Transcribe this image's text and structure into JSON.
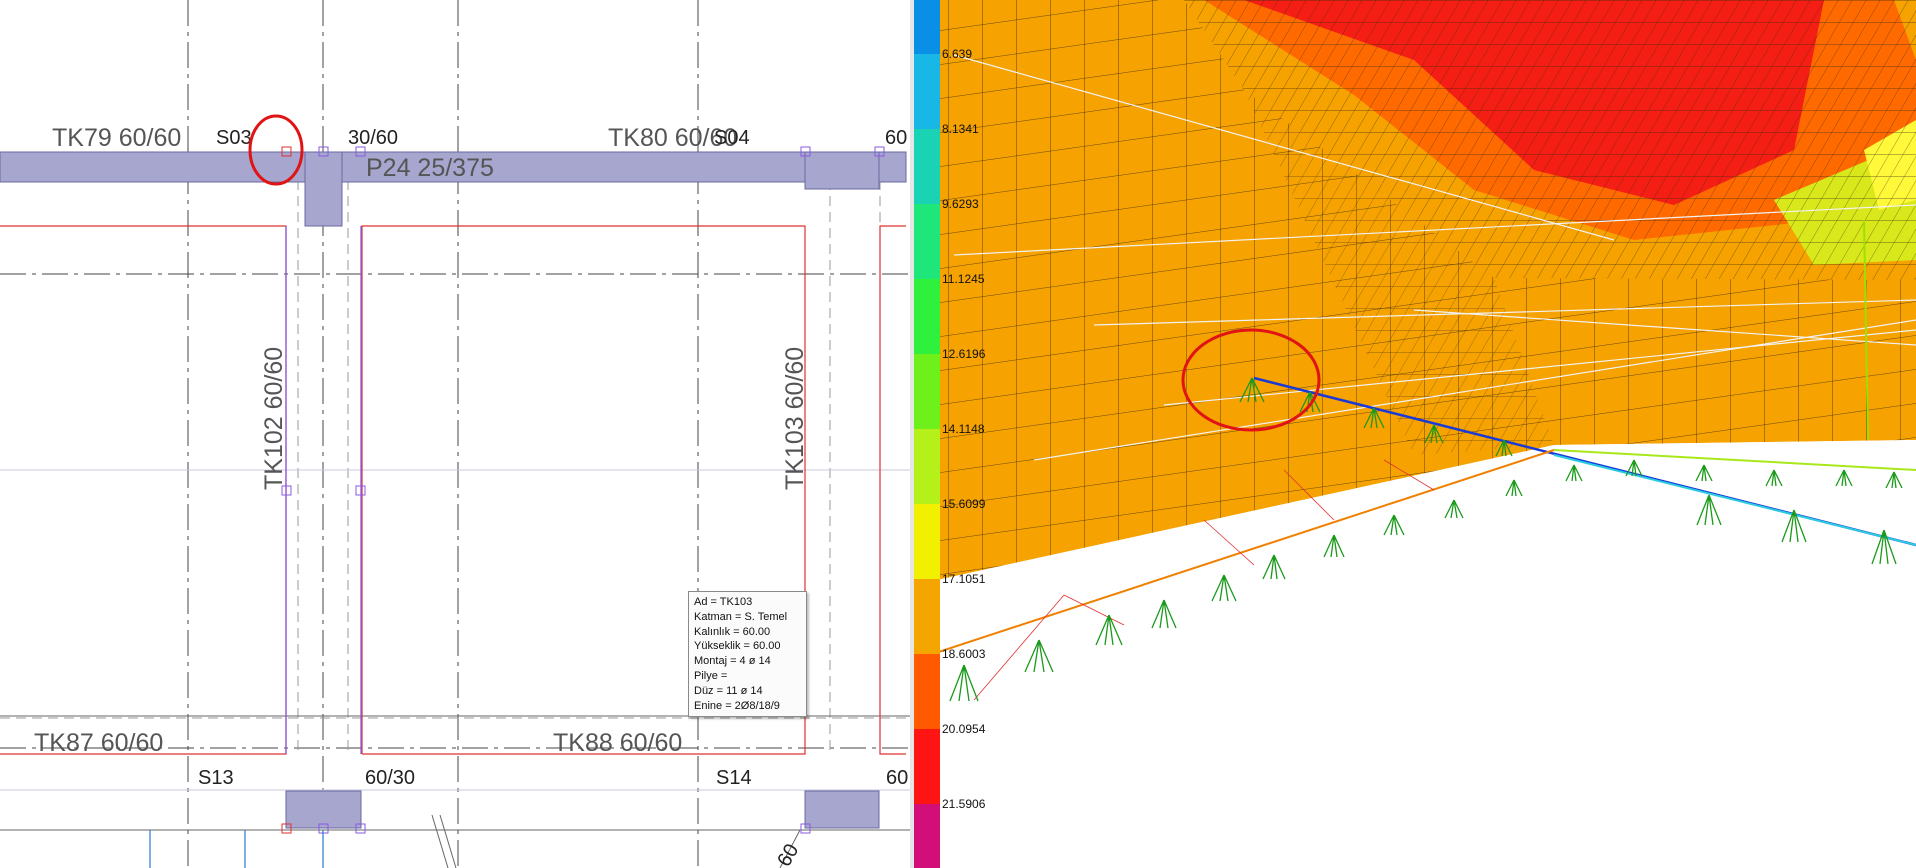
{
  "cad": {
    "beam_labels": {
      "tk79": "TK79 60/60",
      "tk80": "TK80 60/60",
      "tk87": "TK87 60/60",
      "tk88": "TK88 60/60",
      "tk102": "TK102 60/60",
      "tk103": "TK103 60/60",
      "p24": "P24 25/375"
    },
    "column_labels": {
      "s03": "S03",
      "s04": "S04",
      "s13": "S13",
      "s14": "S14",
      "dim_top_mid": "30/60",
      "dim_top_right": "60",
      "dim_bottom_mid": "60/30",
      "dim_bottom_right": "60",
      "dim_bottom_diag": "60"
    },
    "tooltip": {
      "lines": [
        "Ad = TK103",
        "Katman = S. Temel",
        "Kalınlık = 60.00",
        "Yükseklik = 60.00",
        "Montaj = 4 ø 14",
        "Pilye =",
        "Düz = 11 ø 14",
        "Enine = 2Ø8/18/9"
      ]
    }
  },
  "fem": {
    "legend": {
      "values": [
        "6.639",
        "8.1341",
        "9.6293",
        "11.1245",
        "12.6196",
        "14.1148",
        "15.6099",
        "17.1051",
        "18.6003",
        "20.0954",
        "21.5906"
      ],
      "colors": [
        "#0a8fe6",
        "#19b7e6",
        "#19d3b4",
        "#1ee67a",
        "#2ff03c",
        "#6ef01a",
        "#b6f01a",
        "#f0f000",
        "#f5a500",
        "#ff5a00",
        "#ff1414",
        "#d20e78"
      ]
    }
  },
  "annotations": {
    "highlight_color": "#e01414"
  }
}
